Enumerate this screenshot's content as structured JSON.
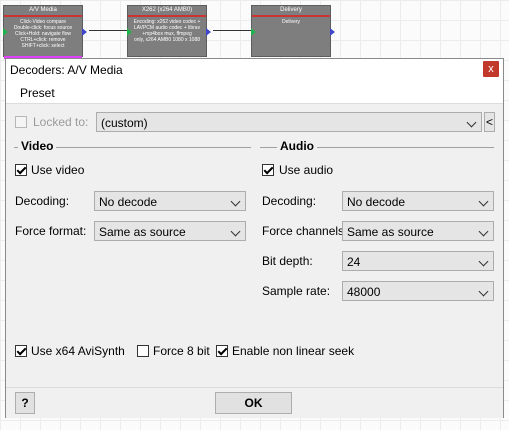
{
  "graph": {
    "nodes": [
      {
        "title": "A/V Media",
        "body": [
          "Click-Video compare",
          "Double-click: focus source",
          "Click+Hold: navigate flow",
          "CTRL+click: remove",
          "SHIFT+click: select"
        ]
      },
      {
        "title": "X262 (x264 AMB0)",
        "body": [
          "Encoding: x262 video codec +",
          "LAVPCM audio codec + librav",
          "+mp4box mux, ffmpeg",
          "only, x264 AMB0 1080 x 1088"
        ]
      },
      {
        "title": "Delivery",
        "body": [
          "Delivery"
        ]
      }
    ]
  },
  "dialog": {
    "title": "Decoders: A/V Media",
    "close": "x",
    "menu": {
      "preset": "Preset"
    },
    "locked": {
      "label": "Locked to:",
      "checked": false,
      "value": "(custom)",
      "side_button": "<"
    },
    "video": {
      "section_title": "Video",
      "use_video": {
        "label": "Use video",
        "checked": true
      },
      "decoding": {
        "label": "Decoding:",
        "value": "No decode"
      },
      "force_format": {
        "label": "Force format:",
        "value": "Same as source"
      }
    },
    "audio": {
      "section_title": "Audio",
      "use_audio": {
        "label": "Use audio",
        "checked": true
      },
      "decoding": {
        "label": "Decoding:",
        "value": "No decode"
      },
      "force_channels": {
        "label": "Force channels:",
        "value": "Same as source"
      },
      "bit_depth": {
        "label": "Bit depth:",
        "value": "24"
      },
      "sample_rate": {
        "label": "Sample rate:",
        "value": "48000"
      }
    },
    "options": {
      "use_x64_avisynth": {
        "label": "Use x64 AviSynth",
        "checked": true
      },
      "force_8bit": {
        "label": "Force 8 bit",
        "checked": false
      },
      "non_linear_seek": {
        "label": "Enable non linear seek",
        "checked": true
      }
    },
    "footer": {
      "help": "?",
      "ok": "OK"
    }
  },
  "colors": {
    "node_body": "#7e7e7e",
    "node_title_accent": "#cc3333",
    "close_button": "#c0392b",
    "dialog_bg": "#f0f0f0"
  }
}
